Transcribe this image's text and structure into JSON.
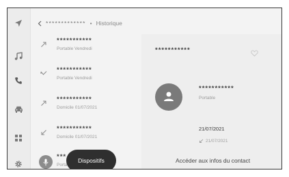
{
  "header": {
    "back_icon": "chevron-left-icon",
    "masked_number": "*************",
    "separator": "•",
    "title": "Historique"
  },
  "sidebar": {
    "items": [
      {
        "icon": "navigation-arrow-icon"
      },
      {
        "icon": "music-note-icon"
      },
      {
        "icon": "phone-icon",
        "active": true
      },
      {
        "icon": "car-icon"
      },
      {
        "icon": "apps-grid-icon"
      },
      {
        "icon": "settings-gear-icon"
      }
    ]
  },
  "calls": [
    {
      "direction": "outgoing",
      "name": "***********",
      "detail": "Portable Vendredi"
    },
    {
      "direction": "missed",
      "name": "***********",
      "detail": "Portable Vendredi"
    },
    {
      "direction": "outgoing",
      "name": "***********",
      "detail": "Domicile 01/07/2021"
    },
    {
      "direction": "incoming",
      "name": "***********",
      "detail": "Domicile 01/07/2021"
    },
    {
      "direction": "outgoing",
      "name": "***",
      "detail": "Portable"
    }
  ],
  "detail": {
    "name": "***********",
    "favorite_icon": "heart-outline-icon",
    "avatar_icon": "person-icon",
    "contact_name": "***********",
    "contact_type": "Portable",
    "date": "21/07/2021",
    "date_sub": "21/07/2021",
    "contact_info_link": "Accéder aux infos du contact"
  },
  "voice": {
    "icon": "microphone-icon",
    "tooltip": "Dispositifs"
  }
}
